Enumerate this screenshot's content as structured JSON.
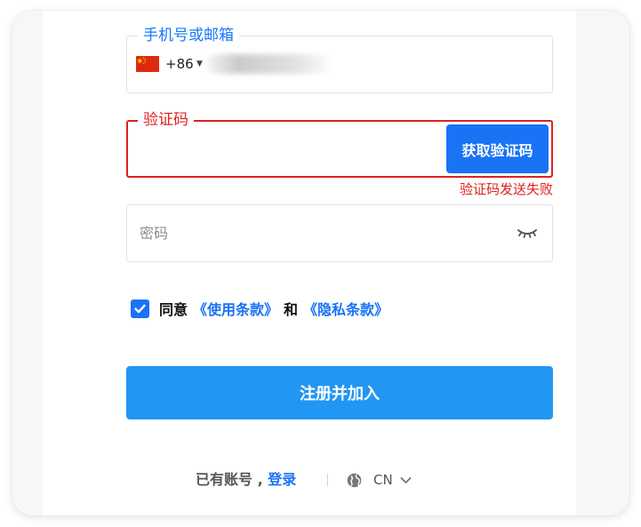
{
  "phone": {
    "legend": "手机号或邮箱",
    "country_code": "+86"
  },
  "code": {
    "legend": "验证码",
    "get_code_label": "获取验证码",
    "error_message": "验证码发送失败"
  },
  "password": {
    "placeholder": "密码",
    "value": ""
  },
  "agreement": {
    "checked": true,
    "prefix": "同意",
    "terms_link": "《使用条款》",
    "connector": "和",
    "privacy_link": "《隐私条款》"
  },
  "register_label": "注册并加入",
  "footer": {
    "have_account": "已有账号 ,",
    "login_link": "登录",
    "language": "CN"
  },
  "colors": {
    "accent": "#1a73f5",
    "register_button": "#2196f3",
    "error": "#e02020"
  },
  "icons": {
    "flag": "china-flag-icon",
    "eye": "eye-closed-icon",
    "globe": "globe-icon",
    "chevron": "chevron-down-icon",
    "check": "check-icon"
  }
}
